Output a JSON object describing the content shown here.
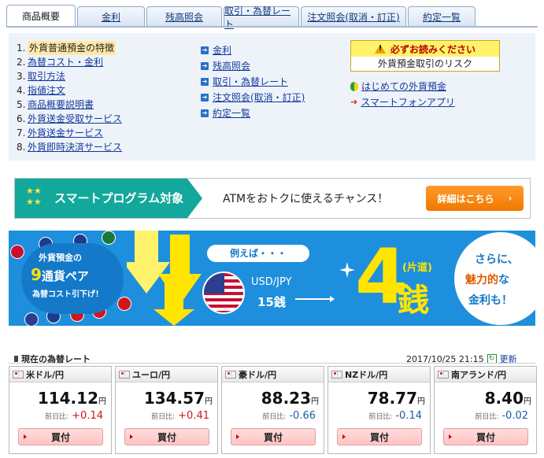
{
  "tabs": [
    {
      "label": "商品概要",
      "active": true
    },
    {
      "label": "金利"
    },
    {
      "label": "残高照会"
    },
    {
      "label": "取引・為替レート"
    },
    {
      "label": "注文照会(取消・訂正)"
    },
    {
      "label": "約定一覧"
    }
  ],
  "summary": {
    "list": [
      {
        "num": "1.",
        "label": "外貨普通預金の特徴"
      },
      {
        "num": "2.",
        "label": "為替コスト・金利"
      },
      {
        "num": "3.",
        "label": "取引方法"
      },
      {
        "num": "4.",
        "label": "指値注文"
      },
      {
        "num": "5.",
        "label": "商品概要説明書"
      },
      {
        "num": "6.",
        "label": "外貨送金受取サービス"
      },
      {
        "num": "7.",
        "label": "外貨送金サービス"
      },
      {
        "num": "8.",
        "label": "外貨即時決済サービス"
      }
    ],
    "links": [
      "金利",
      "残高照会",
      "取引・為替レート",
      "注文照会(取消・訂正)",
      "約定一覧"
    ],
    "warning": {
      "title": "必ずお読みください",
      "subtitle": "外貨預金取引のリスク"
    },
    "side_links": [
      "はじめての外貨預金",
      "スマートフォンアプリ"
    ]
  },
  "banner1": {
    "title": "スマートプログラム対象",
    "text": "ATMをおトクに使えるチャンス！",
    "button": "詳細はこちら"
  },
  "banner2": {
    "line1": "外貨預金の",
    "nine": "9",
    "line2": "通貨ペア",
    "line3": "為替コスト引下げ！",
    "example": "例えば・・・",
    "pair": "USD/JPY",
    "pips": "15銭",
    "big_num": "4",
    "katamichi": "(片道)",
    "sen": "銭",
    "right1": "さらに、",
    "right2a": "魅力的",
    "right2b": "な",
    "right3": "金利も！"
  },
  "rates": {
    "title": "現在の為替レート",
    "timestamp": "2017/10/25 21:15",
    "refresh": "更新",
    "diff_label": "前日比:",
    "buy_label": "買付",
    "items": [
      {
        "name": "米ドル/円",
        "price": "114.12",
        "unit": "円",
        "diff": "+0.14",
        "dir": "up"
      },
      {
        "name": "ユーロ/円",
        "price": "134.57",
        "unit": "円",
        "diff": "+0.41",
        "dir": "up"
      },
      {
        "name": "豪ドル/円",
        "price": "88.23",
        "unit": "円",
        "diff": "-0.66",
        "dir": "down"
      },
      {
        "name": "NZドル/円",
        "price": "78.77",
        "unit": "円",
        "diff": "-0.14",
        "dir": "down"
      },
      {
        "name": "南アランド/円",
        "price": "8.40",
        "unit": "円",
        "diff": "-0.02",
        "dir": "down"
      }
    ]
  },
  "colors": {
    "accent": "#1e8fdc",
    "green": "#12a89b",
    "orange": "#f07a00",
    "up": "#d0151b",
    "down": "#1a5ca8"
  }
}
